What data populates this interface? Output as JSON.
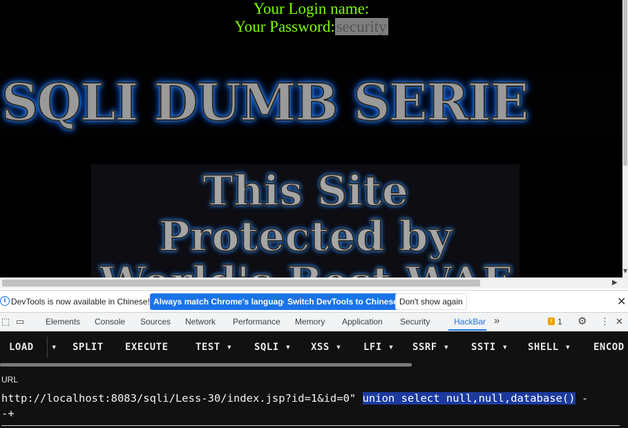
{
  "page": {
    "login_label": "Your Login name:",
    "password_label": "Your Password:",
    "password_value": "security",
    "banner_text": "SQLI DUMB SERIE",
    "waf_lines": [
      "This Site",
      "Protected by",
      "World's Best WAF"
    ]
  },
  "infobar": {
    "message": "DevTools is now available in Chinese!",
    "btn_match_language": "Always match Chrome's language",
    "btn_switch_chinese": "Switch DevTools to Chinese",
    "btn_dont_show": "Don't show again"
  },
  "devtools_tabs": [
    "Elements",
    "Console",
    "Sources",
    "Network",
    "Performance",
    "Memory",
    "Application",
    "Security",
    "HackBar"
  ],
  "devtools": {
    "active_tab": "HackBar",
    "warning_count": "1",
    "accent_color": "#1a73e8"
  },
  "hackbar": {
    "buttons": {
      "load": "LOAD",
      "split": "SPLIT",
      "execute": "EXECUTE",
      "test": "TEST",
      "sqli": "SQLI",
      "xss": "XSS",
      "lfi": "LFI",
      "ssrf": "SSRF",
      "ssti": "SSTI",
      "shell": "SHELL",
      "encode": "ENCOD"
    },
    "url_label": "URL",
    "url_value_before": "http://localhost:8083/sqli/Less-30/index.jsp?id=1&id=0\" ",
    "url_value_selected": "union select null,null,database()",
    "url_value_after": " -\n-+"
  }
}
